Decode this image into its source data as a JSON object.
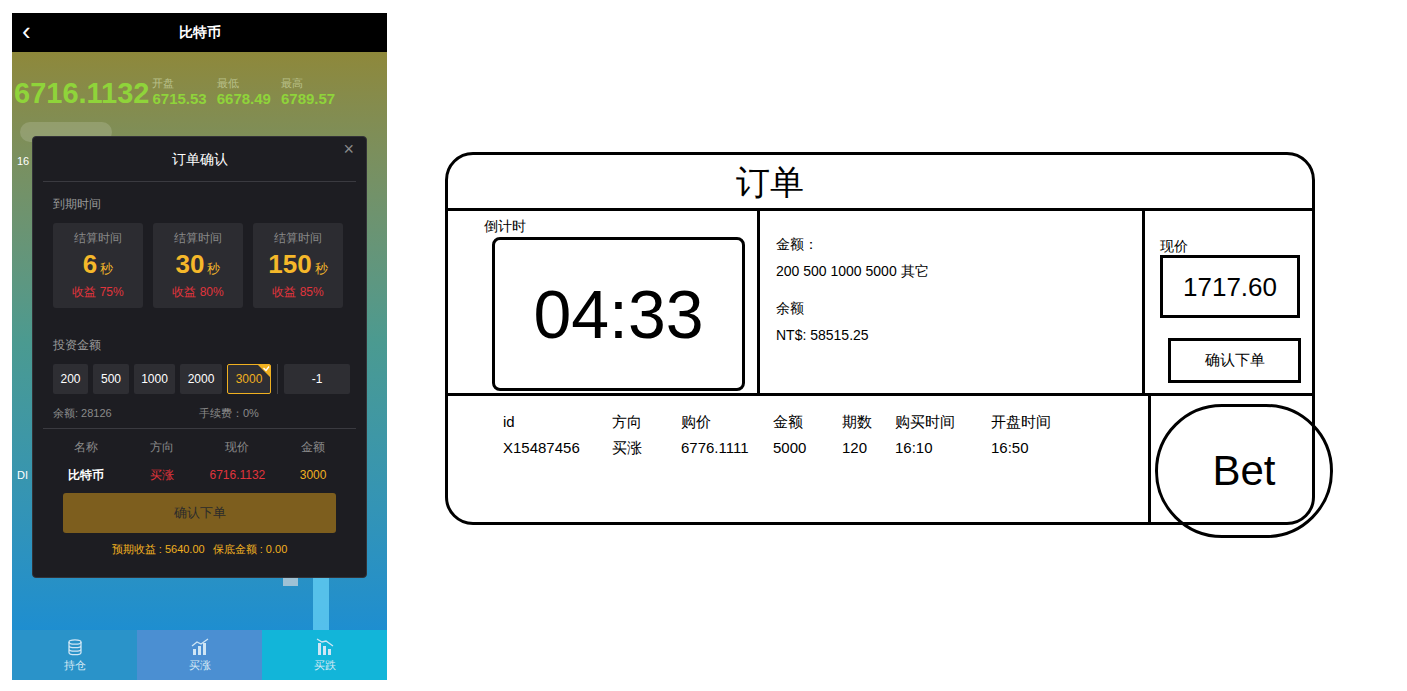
{
  "phone": {
    "header": {
      "back": "‹",
      "title": "比特币"
    },
    "quote": {
      "price": "6716.1132",
      "stats": [
        {
          "label": "开盘",
          "value": "6715.53"
        },
        {
          "label": "最低",
          "value": "6678.49"
        },
        {
          "label": "最高",
          "value": "6789.57"
        }
      ]
    },
    "background_fragments": [
      "16",
      "DI"
    ],
    "modal": {
      "title": "订单确认",
      "close": "×",
      "expiry_label": "到期时间",
      "durations": [
        {
          "caption": "结算时间",
          "value": "6",
          "unit": "秒",
          "profit": "收益 75%",
          "selected": false
        },
        {
          "caption": "结算时间",
          "value": "30",
          "unit": "秒",
          "profit": "收益 80%",
          "selected": false
        },
        {
          "caption": "结算时间",
          "value": "150",
          "unit": "秒",
          "profit": "收益 85%",
          "selected": false
        }
      ],
      "amount_label": "投资金额",
      "amounts": [
        {
          "label": "200",
          "selected": false
        },
        {
          "label": "500",
          "selected": false
        },
        {
          "label": "1000",
          "selected": false
        },
        {
          "label": "2000",
          "selected": false
        },
        {
          "label": "3000",
          "selected": true
        }
      ],
      "custom_amount": "-1",
      "balance": "余额: 28126",
      "fee": "手续费：0%",
      "table": {
        "columns": [
          "名称",
          "方向",
          "现价",
          "金额"
        ],
        "row": [
          "比特币",
          "买涨",
          "6716.1132",
          "3000"
        ]
      },
      "confirm": "确认下单",
      "summary": [
        "预期收益 : 5640.00",
        "保底金额 : 0.00"
      ]
    },
    "tabs": [
      {
        "label": "持仓",
        "selected": false,
        "color": "#2a93c9"
      },
      {
        "label": "买涨",
        "selected": false,
        "color": "#4b8fd2"
      },
      {
        "label": "买跌",
        "selected": false,
        "color": "#12b5d9"
      }
    ]
  },
  "sketch": {
    "title": "订单",
    "countdown": {
      "label": "倒计时",
      "value": "04:33"
    },
    "amount": {
      "label": "金额：",
      "options": "200 500 1000 5000 其它",
      "balance_label": "余额",
      "balance": "NT$: 58515.25"
    },
    "price": {
      "label": "现价",
      "value": "1717.60"
    },
    "confirm": "确认下单",
    "order": {
      "columns": [
        "id",
        "方向",
        "购价",
        "金额",
        "期数",
        "购买时间",
        "开盘时间"
      ],
      "row": [
        "X15487456",
        "买涨",
        "6776.1111",
        "5000",
        "120",
        "16:10",
        "16:50"
      ]
    },
    "bet": "Bet"
  }
}
